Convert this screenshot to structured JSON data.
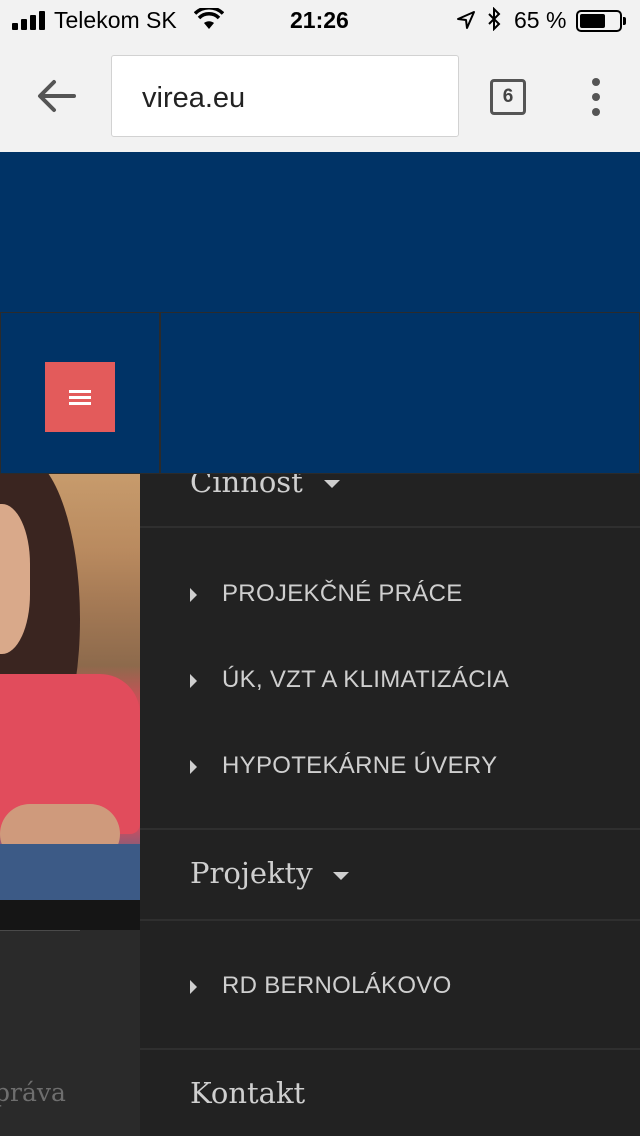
{
  "status_bar": {
    "carrier": "Telekom SK",
    "time": "21:26",
    "battery_text": "65 %",
    "battery_level": 0.65,
    "icons": [
      "signal-icon",
      "wifi-icon",
      "location-arrow-icon",
      "bluetooth-icon",
      "battery-icon"
    ]
  },
  "browser": {
    "url": "virea.eu",
    "tab_count": "6",
    "icons": [
      "back-arrow-icon",
      "tab-switcher-icon",
      "overflow-menu-icon"
    ]
  },
  "site": {
    "header_color": "#003366",
    "hamburger_color": "#e35b5b",
    "hamburger_icon": "hamburger-menu-icon"
  },
  "page": {
    "footer_text": "práva"
  },
  "menu": {
    "background": "#222222",
    "sections": [
      {
        "heading": "Činnosť",
        "expanded": true,
        "items": [
          "PROJEKČNÉ PRÁCE",
          "ÚK, VZT A KLIMATIZÁCIA",
          "HYPOTEKÁRNE ÚVERY"
        ]
      },
      {
        "heading": "Projekty",
        "expanded": true,
        "items": [
          "RD BERNOLÁKOVO"
        ]
      },
      {
        "heading": "Kontakt",
        "expanded": false,
        "items": []
      }
    ]
  }
}
